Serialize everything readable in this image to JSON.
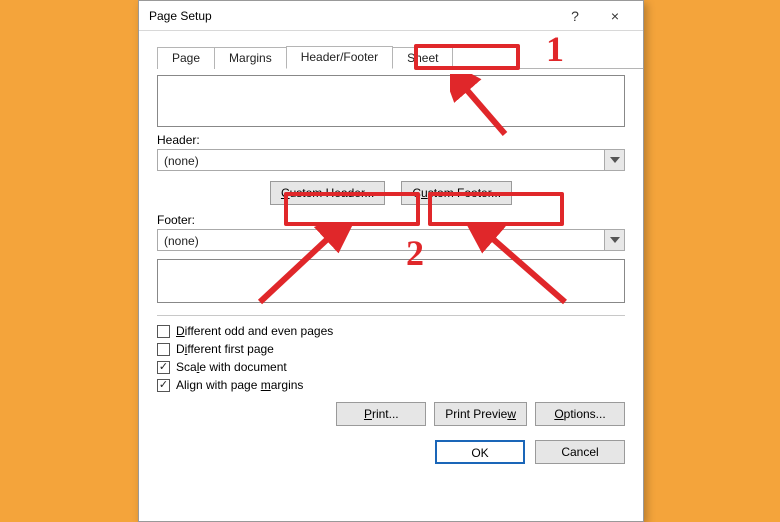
{
  "dialog": {
    "title": "Page Setup",
    "help_tooltip": "?",
    "close_tooltip": "×"
  },
  "tabs": {
    "page": "Page",
    "margins": "Margins",
    "header_footer": "Header/Footer",
    "sheet": "Sheet"
  },
  "header_section": {
    "label": "Header:",
    "value": "(none)"
  },
  "custom_buttons": {
    "header": "Custom Header...",
    "footer": "Custom Footer..."
  },
  "footer_section": {
    "label": "Footer:",
    "value": "(none)"
  },
  "checkboxes": {
    "diff_odd_even": "Different odd and even pages",
    "diff_first": "Different first page",
    "scale_doc": "Scale with document",
    "align_margins": "Align with page margins"
  },
  "bottom_buttons": {
    "print": "Print...",
    "print_preview": "Print Preview",
    "options": "Options..."
  },
  "ok_cancel": {
    "ok": "OK",
    "cancel": "Cancel"
  },
  "annotations": {
    "num1": "1",
    "num2": "2"
  }
}
